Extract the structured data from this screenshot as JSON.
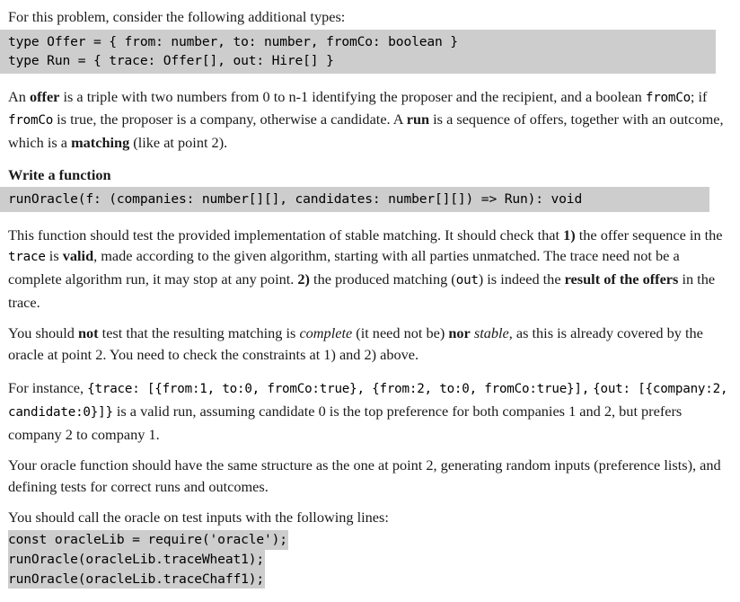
{
  "document": {
    "intro_paragraph": "For this problem, consider the following additional types:",
    "types_code": "type Offer = { from: number, to: number, fromCo: boolean }\ntype Run = { trace: Offer[], out: Hire[] }",
    "offer_definition": {
      "line1_pre": "An ",
      "line1_bold": "offer",
      "line1_post": " is a triple with two numbers from 0 to n-1 identifying the proposer and the recipient,",
      "line2_pre": "and a boolean ",
      "line2_code1": "fromCo",
      "line2_mid": "; if ",
      "line2_code2": "fromCo",
      "line2_post": " is true, the proposer is a company, otherwise a candidate.",
      "line3_pre": "A ",
      "line3_bold": "run",
      "line3_mid": " is a sequence of offers, together with an outcome, which is a ",
      "line3_bold2": "matching",
      "line3_post": " (like at point 2)."
    },
    "write_a_function_heading": "Write a function",
    "signature_code": "runOracle(f: (companies: number[][], candidates: number[][]) => Run): void",
    "test_requirements": {
      "lead": "This function should test the provided implementation of stable matching. It should check that",
      "item1_num": "1)",
      "item1_pre": " the offer sequence in the ",
      "item1_code": "trace",
      "item1_mid": " is ",
      "item1_bold": "valid",
      "item1_post": ", made according to the given algorithm, starting with",
      "item1_cont": "all parties unmatched. The trace need not be a complete algorithm run, it may stop at any point.",
      "item2_num": "2)",
      "item2_pre": " the produced matching (",
      "item2_code": "out",
      "item2_mid": ") is indeed the ",
      "item2_bold": "result of the offers",
      "item2_post": " in the trace."
    },
    "not_test": {
      "pre": "You should ",
      "bold1": "not",
      "mid1": " test that the resulting matching is ",
      "ital1": "complete",
      "mid2": " (it need not be) ",
      "bold2": "nor",
      "mid3": " ",
      "ital2": "stable",
      "post": ", as this is",
      "line2": "already covered by the oracle at point 2. You need to check the constraints at 1) and 2) above."
    },
    "example": {
      "line1_pre": "For instance, ",
      "line1_code": "{trace: [{from:1, to:0, fromCo:true}, {from:2, to:0, fromCo:true}],",
      "line2_code": "{out: [{company:2, candidate:0}]}",
      "line2_post": " is a valid run, assuming  candidate 0 is the top",
      "line3": "preference for both companies 1 and 2, but prefers company 2 to company 1."
    },
    "structure_note": {
      "line1": "Your oracle function should have the same structure as the one at point 2, generating random",
      "line2": "inputs (preference lists), and defining tests for correct runs and outcomes."
    },
    "call_note": "You should call the oracle on test inputs with the following lines:",
    "call_code_lines": [
      "const oracleLib = require('oracle');",
      "runOracle(oracleLib.traceWheat1);",
      "runOracle(oracleLib.traceChaff1);"
    ]
  },
  "colors": {
    "page_background": "#ffffff",
    "code_background": "#cdcdcd",
    "text": "#111111"
  }
}
